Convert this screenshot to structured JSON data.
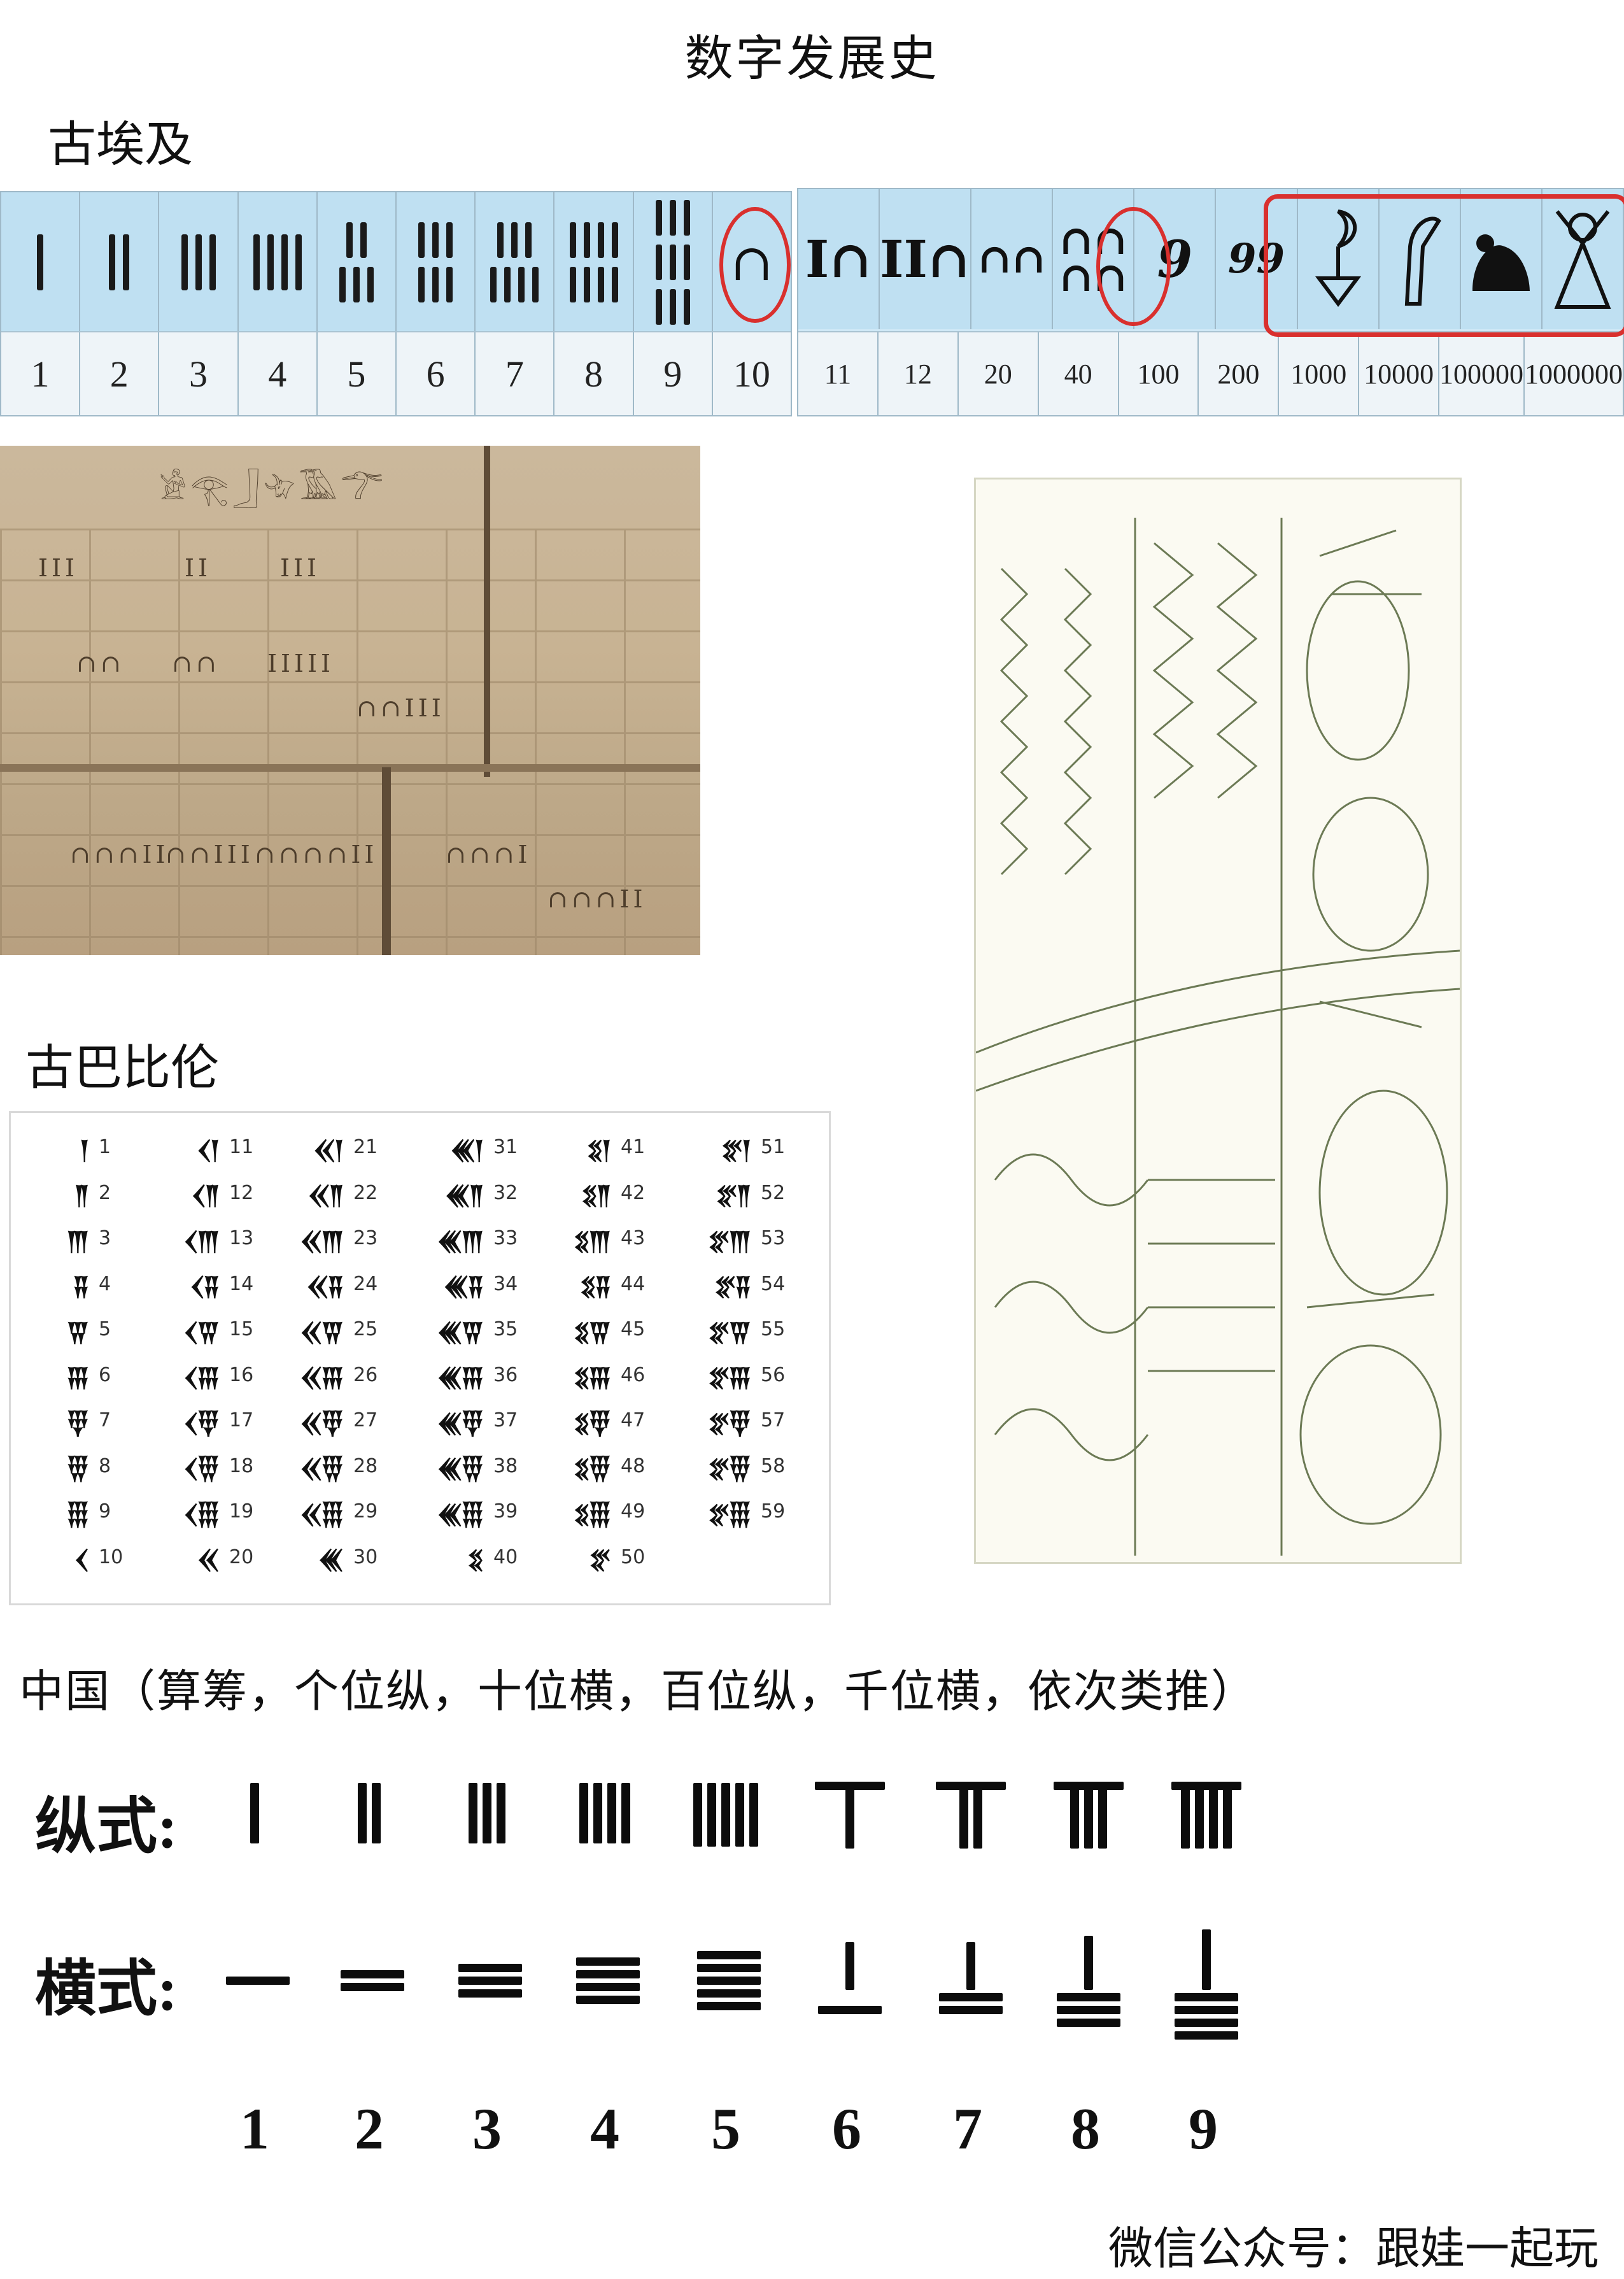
{
  "title": "数字发展史",
  "egypt": {
    "heading": "古埃及",
    "table1_numbers": [
      "1",
      "2",
      "3",
      "4",
      "5",
      "6",
      "7",
      "8",
      "9",
      "10"
    ],
    "table2_numbers": [
      "11",
      "12",
      "20",
      "40",
      "100",
      "200",
      "1000",
      "10000",
      "100000",
      "1000000"
    ],
    "table2_glyphs": [
      "∩",
      "∩",
      "∩∩",
      "∩∩",
      "9",
      "99",
      "lotus-icon",
      "finger-icon",
      "frog-icon",
      "god-icon"
    ]
  },
  "babylon": {
    "heading": "古巴比伦",
    "columns": [
      {
        "symbols": [
          "𒁹",
          "𒈫",
          "𒐈",
          "𒐉",
          "𒐊",
          "𒐋",
          "𒑂",
          "𒑄",
          "𒑆",
          "𒌋"
        ],
        "numbers": [
          "1",
          "2",
          "3",
          "4",
          "5",
          "6",
          "7",
          "8",
          "9",
          "10"
        ]
      },
      {
        "symbols": [
          "𒌋𒁹",
          "𒌋𒈫",
          "𒌋𒐈",
          "𒌋𒐉",
          "𒌋𒐊",
          "𒌋𒐋",
          "𒌋𒑂",
          "𒌋𒑄",
          "𒌋𒑆",
          "𒎙"
        ],
        "numbers": [
          "11",
          "12",
          "13",
          "14",
          "15",
          "16",
          "17",
          "18",
          "19",
          "20"
        ]
      },
      {
        "symbols": [
          "𒎙𒁹",
          "𒎙𒈫",
          "𒎙𒐈",
          "𒎙𒐉",
          "𒎙𒐊",
          "𒎙𒐋",
          "𒎙𒑂",
          "𒎙𒑄",
          "𒎙𒑆",
          "𒌍"
        ],
        "numbers": [
          "21",
          "22",
          "23",
          "24",
          "25",
          "26",
          "27",
          "28",
          "29",
          "30"
        ]
      },
      {
        "symbols": [
          "𒌍𒁹",
          "𒌍𒈫",
          "𒌍𒐈",
          "𒌍𒐉",
          "𒌍𒐊",
          "𒌍𒐋",
          "𒌍𒑂",
          "𒌍𒑄",
          "𒌍𒑆",
          "𒐏"
        ],
        "numbers": [
          "31",
          "32",
          "33",
          "34",
          "35",
          "36",
          "37",
          "38",
          "39",
          "40"
        ]
      },
      {
        "symbols": [
          "𒐏𒁹",
          "𒐏𒈫",
          "𒐏𒐈",
          "𒐏𒐉",
          "𒐏𒐊",
          "𒐏𒐋",
          "𒐏𒑂",
          "𒐏𒑄",
          "𒐏𒑆",
          "𒐐"
        ],
        "numbers": [
          "41",
          "42",
          "43",
          "44",
          "45",
          "46",
          "47",
          "48",
          "49",
          "50"
        ]
      },
      {
        "symbols": [
          "𒐐𒁹",
          "𒐐𒈫",
          "𒐐𒐈",
          "𒐐𒐉",
          "𒐐𒐊",
          "𒐐𒐋",
          "𒐐𒑂",
          "𒐐𒑄",
          "𒐐𒑆"
        ],
        "numbers": [
          "51",
          "52",
          "53",
          "54",
          "55",
          "56",
          "57",
          "58",
          "59"
        ]
      }
    ]
  },
  "china": {
    "heading": "中国（算筹，个位纵，十位横，百位纵，千位横，依次类推）",
    "vertical_label": "纵式:",
    "horizontal_label": "横式:",
    "digits": [
      "1",
      "2",
      "3",
      "4",
      "5",
      "6",
      "7",
      "8",
      "9"
    ]
  },
  "footer": "微信公众号：跟娃一起玩",
  "colors": {
    "highlight": "#d9302e",
    "table_bg": "#bfe0f2"
  }
}
